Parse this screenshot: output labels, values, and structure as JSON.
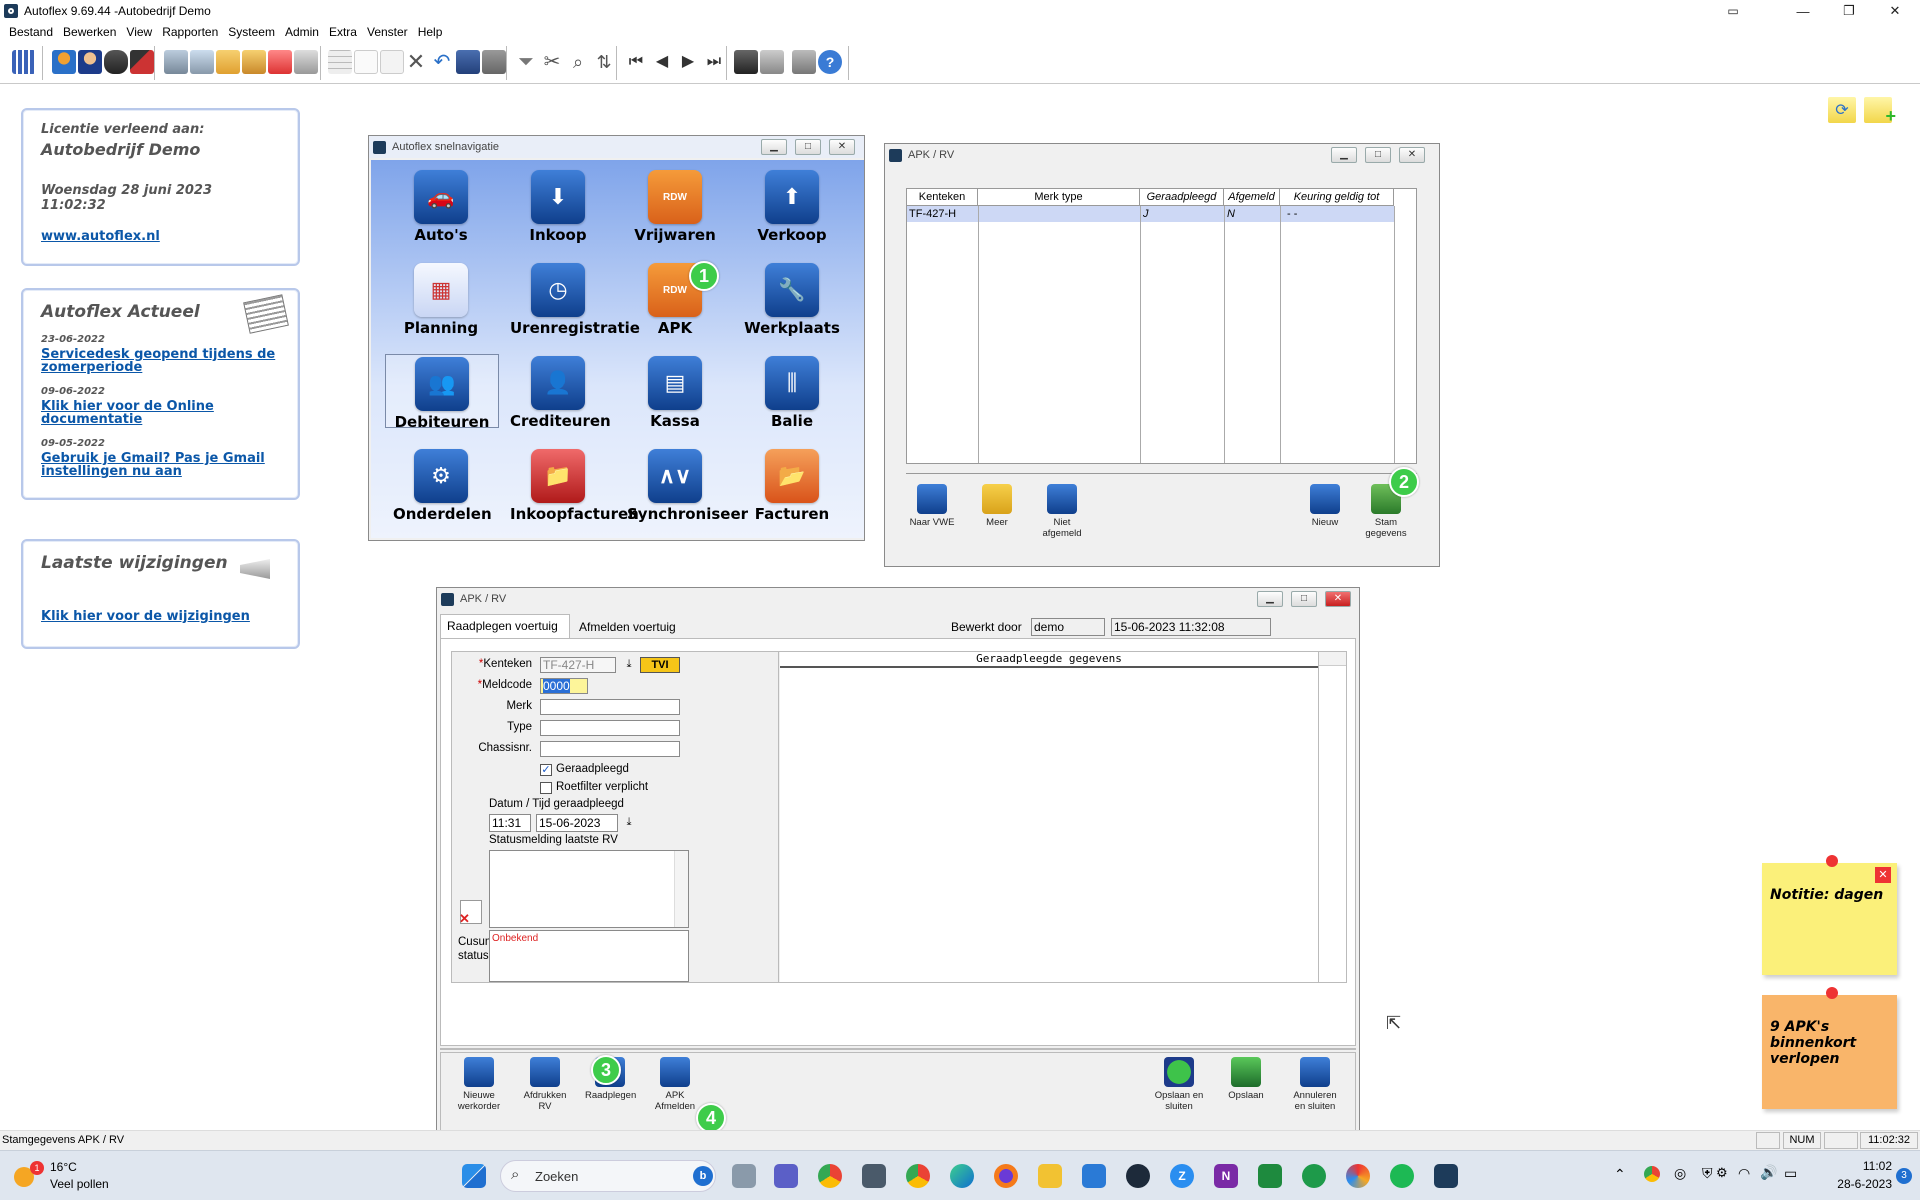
{
  "window": {
    "title": "Autoflex 9.69.44 -Autobedrijf Demo"
  },
  "menu": [
    "Bestand",
    "Bewerken",
    "View",
    "Rapporten",
    "Systeem",
    "Admin",
    "Extra",
    "Venster",
    "Help"
  ],
  "license_panel": {
    "heading": "Licentie verleend aan:",
    "company": "Autobedrijf Demo",
    "date": "Woensdag 28 juni 2023",
    "time": "11:02:32",
    "link": "www.autoflex.nl"
  },
  "news_panel": {
    "title": "Autoflex Actueel",
    "items": [
      {
        "date": "23-06-2022",
        "text1": "Servicedesk geopend tijdens de",
        "text2": "zomerperiode"
      },
      {
        "date": "09-06-2022",
        "text1": "Klik hier voor de Online",
        "text2": "documentatie"
      },
      {
        "date": "09-05-2022",
        "text1": "Gebruik je Gmail? Pas je Gmail",
        "text2": "instellingen nu aan"
      }
    ]
  },
  "changes_panel": {
    "title": "Laatste wijzigingen",
    "link": "Klik hier voor de wijzigingen"
  },
  "nav_window": {
    "title": "Autoflex snelnavigatie",
    "items": [
      "Auto's",
      "Inkoop",
      "Vrijwaren",
      "Verkoop",
      "Planning",
      "Urenregistratie",
      "APK",
      "Werkplaats",
      "Debiteuren",
      "Crediteuren",
      "Kassa",
      "Balie",
      "Onderdelen",
      "Inkoopfacturen",
      "Synchroniseer",
      "Facturen"
    ],
    "rdw_label": "RDW"
  },
  "badges": [
    "1",
    "2",
    "3",
    "4"
  ],
  "apk_list_window": {
    "title": "APK / RV",
    "columns": [
      "Kenteken",
      "Merk type",
      "Geraadpleegd",
      "Afgemeld",
      "Keuring geldig tot"
    ],
    "row": {
      "kenteken": "TF-427-H",
      "merk_type": "",
      "geraadpleegd": "J",
      "afgemeld": "N",
      "keuring": "-  -"
    },
    "buttons": {
      "naar_vwe": "Naar VWE",
      "meer": "Meer",
      "niet_afgemeld_1": "Niet",
      "niet_afgemeld_2": "afgemeld",
      "nieuw": "Nieuw",
      "stam_1": "Stam",
      "stam_2": "gegevens"
    }
  },
  "apk_form_window": {
    "title": "APK / RV",
    "tabs": [
      "Raadplegen voertuig",
      "Afmelden voertuig"
    ],
    "bewerkt_door_label": "Bewerkt door",
    "bewerkt_door_value": "demo",
    "bewerkt_datetime": "15-06-2023 11:32:08",
    "fields": {
      "kenteken_label": "Kenteken",
      "kenteken_value": "TF-427-H",
      "tvi": "TVI",
      "meldcode_label": "Meldcode",
      "meldcode_value": "0000",
      "merk_label": "Merk",
      "type_label": "Type",
      "chassis_label": "Chassisnr.",
      "geraadpleegd_label": "Geraadpleegd",
      "roetfilter_label": "Roetfilter verplicht",
      "datum_label": "Datum / Tijd geraadpleegd",
      "time_value": "11:31",
      "date_value": "15-06-2023",
      "status_label": "Statusmelding laatste RV",
      "cusum_label_1": "Cusum",
      "cusum_label_2": "status",
      "cusum_value": "Onbekend"
    },
    "consulted_header": "Geraadpleegde gegevens",
    "buttons": {
      "nieuwe_1": "Nieuwe",
      "nieuwe_2": "werkorder",
      "afdrukken_1": "Afdrukken",
      "afdrukken_2": "RV",
      "raadplegen": "Raadplegen",
      "apk_1": "APK",
      "apk_2": "Afmelden",
      "opslaan_sluiten_1": "Opslaan en",
      "opslaan_sluiten_2": "sluiten",
      "opslaan": "Opslaan",
      "annuleren_1": "Annuleren",
      "annuleren_2": "en sluiten"
    }
  },
  "notes": [
    {
      "text": "Notitie: dagen"
    },
    {
      "text": "9 APK's binnenkort verlopen"
    }
  ],
  "statusbar": {
    "text": "Stamgegevens APK / RV",
    "num": "NUM",
    "time": "11:02:32"
  },
  "taskbar": {
    "weather_temp": "16°C",
    "weather_desc": "Veel pollen",
    "weather_badge": "1",
    "search_placeholder": "Zoeken",
    "clock_time": "11:02",
    "clock_date": "28-6-2023",
    "notif_count": "3"
  },
  "colors": {
    "accent": "#0b57a8",
    "badge": "#3ecc4a",
    "note_yellow": "#fbf07a",
    "note_orange": "#f9b56a"
  }
}
